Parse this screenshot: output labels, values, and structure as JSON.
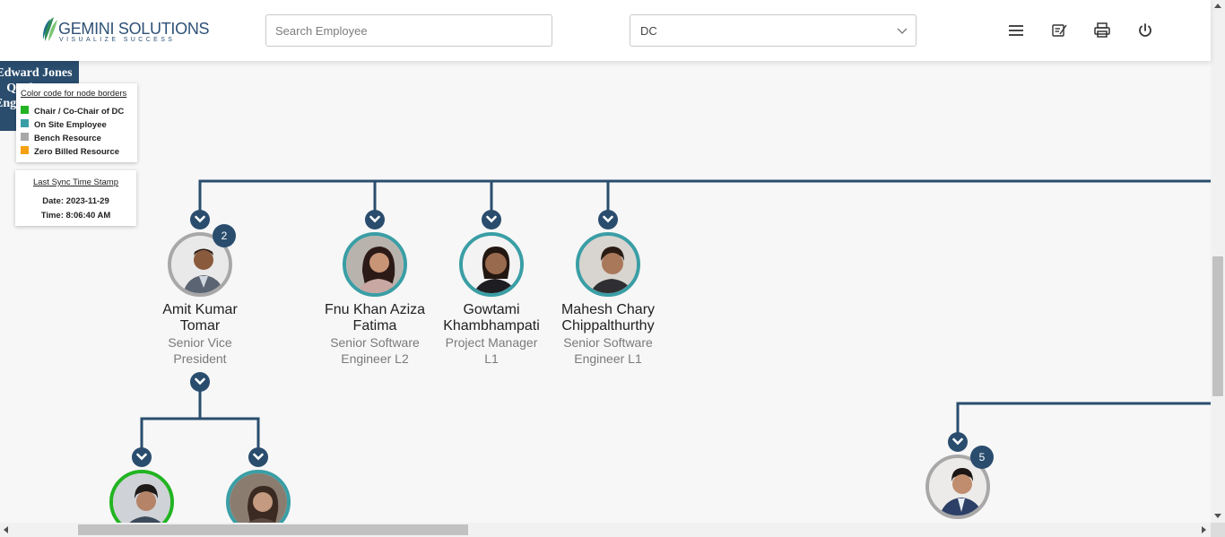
{
  "header": {
    "logo_name": "GEMINI SOLUTIONS",
    "logo_tagline": "VISUALIZE SUCCESS",
    "search_placeholder": "Search Employee",
    "dc_selected": "DC",
    "icons": [
      "menu-icon",
      "notes-icon",
      "print-icon",
      "power-icon"
    ]
  },
  "root_node": {
    "name": "Edward Jones",
    "line2": "Qual",
    "line3": "Eng"
  },
  "legend": {
    "title": "Color code for node borders",
    "items": [
      {
        "label": "Chair / Co-Chair of DC",
        "color": "#22b422"
      },
      {
        "label": "On Site Employee",
        "color": "#3a9ea5"
      },
      {
        "label": "Bench Resource",
        "color": "#a8a8a8"
      },
      {
        "label": "Zero Billed Resource",
        "color": "#f5a00f"
      }
    ]
  },
  "sync": {
    "title": "Last Sync Time Stamp",
    "date": "Date: 2023-11-29",
    "time": "Time: 8:06:40 AM"
  },
  "employees": [
    {
      "name_l1": "Amit Kumar",
      "name_l2": "Tomar",
      "title_l1": "Senior Vice",
      "title_l2": "President",
      "badge": "2",
      "border": "#a8a8a8"
    },
    {
      "name_l1": "Fnu Khan Aziza",
      "name_l2": "Fatima",
      "title_l1": "Senior Software",
      "title_l2": "Engineer L2",
      "badge": "",
      "border": "#3a9ea5"
    },
    {
      "name_l1": "Gowtami",
      "name_l2": "Khambhampati",
      "title_l1": "Project Manager",
      "title_l2": "L1",
      "badge": "",
      "border": "#3a9ea5"
    },
    {
      "name_l1": "Mahesh Chary",
      "name_l2": "Chippalthurthy",
      "title_l1": "Senior Software",
      "title_l2": "Engineer L1",
      "badge": "",
      "border": "#3a9ea5"
    },
    {
      "name_l1": "",
      "name_l2": "",
      "title_l1": "",
      "title_l2": "",
      "badge": "",
      "border": "#22b422"
    },
    {
      "name_l1": "",
      "name_l2": "",
      "title_l1": "",
      "title_l2": "",
      "badge": "",
      "border": "#3a9ea5"
    },
    {
      "name_l1": "",
      "name_l2": "",
      "title_l1": "",
      "title_l2": "",
      "badge": "5",
      "border": "#a8a8a8"
    }
  ],
  "colors": {
    "connector": "#2a4d6e",
    "brand": "#2e5176"
  }
}
